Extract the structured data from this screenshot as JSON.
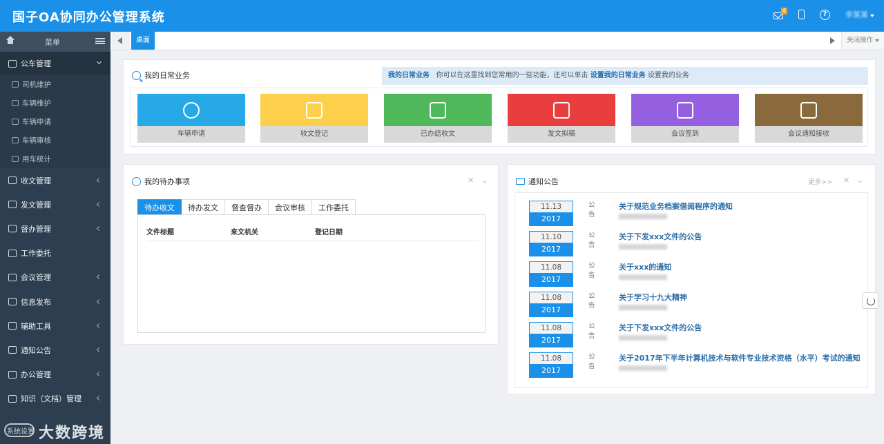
{
  "app": {
    "title": "国子OA协同办公管理系统",
    "mail_badge": "4",
    "user_name": "李某某"
  },
  "sidebar": {
    "header_label": "菜单",
    "items": [
      {
        "label": "公车管理"
      },
      {
        "label": "收文管理"
      },
      {
        "label": "发文管理"
      },
      {
        "label": "督办管理"
      },
      {
        "label": "工作委托"
      },
      {
        "label": "会议管理"
      },
      {
        "label": "信息发布"
      },
      {
        "label": "辅助工具"
      },
      {
        "label": "通知公告"
      },
      {
        "label": "办公管理"
      },
      {
        "label": "知识（文档）管理"
      }
    ],
    "sub_items": [
      {
        "label": "司机维护"
      },
      {
        "label": "车辆维护"
      },
      {
        "label": "车辆申请"
      },
      {
        "label": "车辆审核"
      },
      {
        "label": "用车统计"
      }
    ],
    "bottom_text": "系统设置",
    "watermark": "大数跨境"
  },
  "tabbar": {
    "active_tab": "桌面",
    "close_ops": "关闭操作"
  },
  "daily": {
    "title": "我的日常业务",
    "info_prefix": "我的日常业务",
    "info_middle": "你可以在这里找到您常用的一些功能，还可以单击",
    "info_link": "设置我的日常业务",
    "info_suffix": "设置我的业务",
    "tiles": [
      {
        "label": "车辆申请",
        "color": "#27a9e8"
      },
      {
        "label": "收文登记",
        "color": "#fdcf4b"
      },
      {
        "label": "已办结收文",
        "color": "#4fb85a"
      },
      {
        "label": "发文拟稿",
        "color": "#ea3e3e"
      },
      {
        "label": "会议签到",
        "color": "#9460e0"
      },
      {
        "label": "会议通知接收",
        "color": "#8a6a3c"
      }
    ]
  },
  "pending": {
    "title": "我的待办事项",
    "tabs": [
      "待办收文",
      "待办发文",
      "督查督办",
      "会议审核",
      "工作委托"
    ],
    "columns": [
      "文件标题",
      "来文机关",
      "登记日期"
    ]
  },
  "notices": {
    "title": "通知公告",
    "more": "更多>>",
    "kind": "公告",
    "items": [
      {
        "md": "11.13",
        "year": "2017",
        "title": "关于规范业务档案借阅程序的通知"
      },
      {
        "md": "11.10",
        "year": "2017",
        "title": "关于下发xxx文件的公告"
      },
      {
        "md": "11.08",
        "year": "2017",
        "title": "关于xxx的通知"
      },
      {
        "md": "11.08",
        "year": "2017",
        "title": "关于学习十九大精神"
      },
      {
        "md": "11.08",
        "year": "2017",
        "title": "关于下发xxx文件的公告"
      },
      {
        "md": "11.08",
        "year": "2017",
        "title": "关于2017年下半年计算机技术与软件专业技术资格（水平）考试的通知"
      }
    ]
  }
}
